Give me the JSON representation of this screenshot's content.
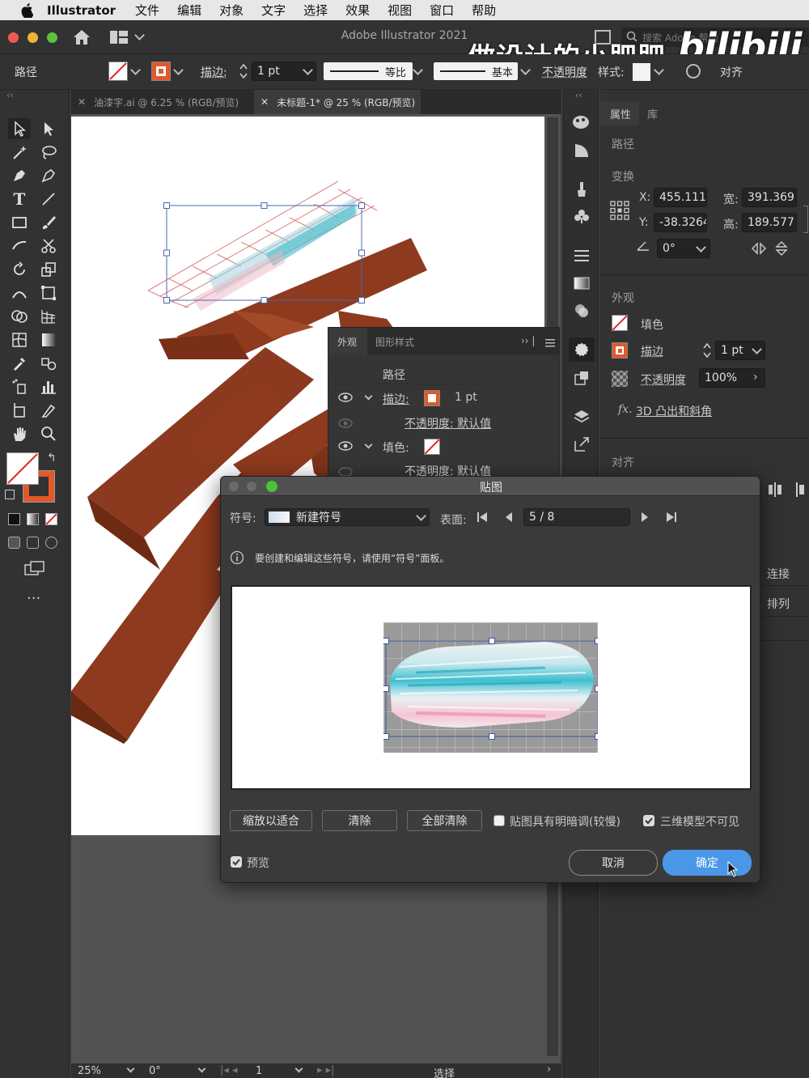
{
  "menubar": {
    "app": "Illustrator",
    "items": [
      "文件",
      "编辑",
      "对象",
      "文字",
      "选择",
      "效果",
      "视图",
      "窗口",
      "帮助"
    ]
  },
  "titlebar": {
    "title": "Adobe Illustrator 2021",
    "search_placeholder": "搜索 Adobe 帮助",
    "watermark_text": "做设计的小肥肥",
    "watermark_logo": "bilibili"
  },
  "controlbar": {
    "object_type": "路径",
    "stroke_label": "描边:",
    "stroke_weight": "1 pt",
    "profile": "等比",
    "brush": "基本",
    "opacity_label": "不透明度",
    "style_label": "样式:",
    "align_label": "对齐"
  },
  "tabs": [
    {
      "label": "油漆字.ai @ 6.25 % (RGB/预览)"
    },
    {
      "label": "未标题-1* @ 25 % (RGB/预览)"
    }
  ],
  "props": {
    "tab_properties": "属性",
    "tab_libraries": "库",
    "object": "路径",
    "transform_title": "变换",
    "x_label": "X:",
    "x_value": "455.111",
    "y_label": "Y:",
    "y_value": "-38.3264",
    "w_label": "宽:",
    "w_value": "391.369",
    "h_label": "高:",
    "h_value": "189.577",
    "angle_value": "0°",
    "appearance_title": "外观",
    "fill_label": "填色",
    "stroke_label": "描边",
    "stroke_weight": "1 pt",
    "opacity_label": "不透明度",
    "opacity_value": "100%",
    "fx_label": "3D 凸出和斜角",
    "align_title": "对齐",
    "connect_label": "连接",
    "arrange_label": "排列"
  },
  "appearance_panel": {
    "tab_appearance": "外观",
    "tab_graphic_styles": "图形样式",
    "path_label": "路径",
    "stroke_label": "描边:",
    "stroke_weight": "1 pt",
    "opacity_row": "不透明度: 默认值",
    "fill_label": "填色:",
    "opacity_row2": "不透明度: 默认值"
  },
  "dialog": {
    "title": "贴图",
    "symbol_label": "符号:",
    "symbol_value": "新建符号",
    "surface_label": "表面:",
    "surface_value": "5 / 8",
    "info_text": "要创建和编辑这些符号，请使用“符号”面板。",
    "btn_fit": "缩放以适合",
    "btn_clear": "清除",
    "btn_clear_all": "全部清除",
    "shade_label": "贴图具有明暗调(较慢)",
    "shade_checked": false,
    "invisible_label": "三维模型不可见",
    "invisible_checked": true,
    "preview_label": "预览",
    "preview_checked": true,
    "cancel_label": "取消",
    "ok_label": "确定"
  },
  "status": {
    "zoom": "25%",
    "rotation": "0°",
    "artboard": "1",
    "mode": "选择"
  },
  "colors": {
    "brand_brown": "#8e3a1e",
    "accent_blue": "#4a97e8",
    "stroke_orange": "#e0592a"
  }
}
